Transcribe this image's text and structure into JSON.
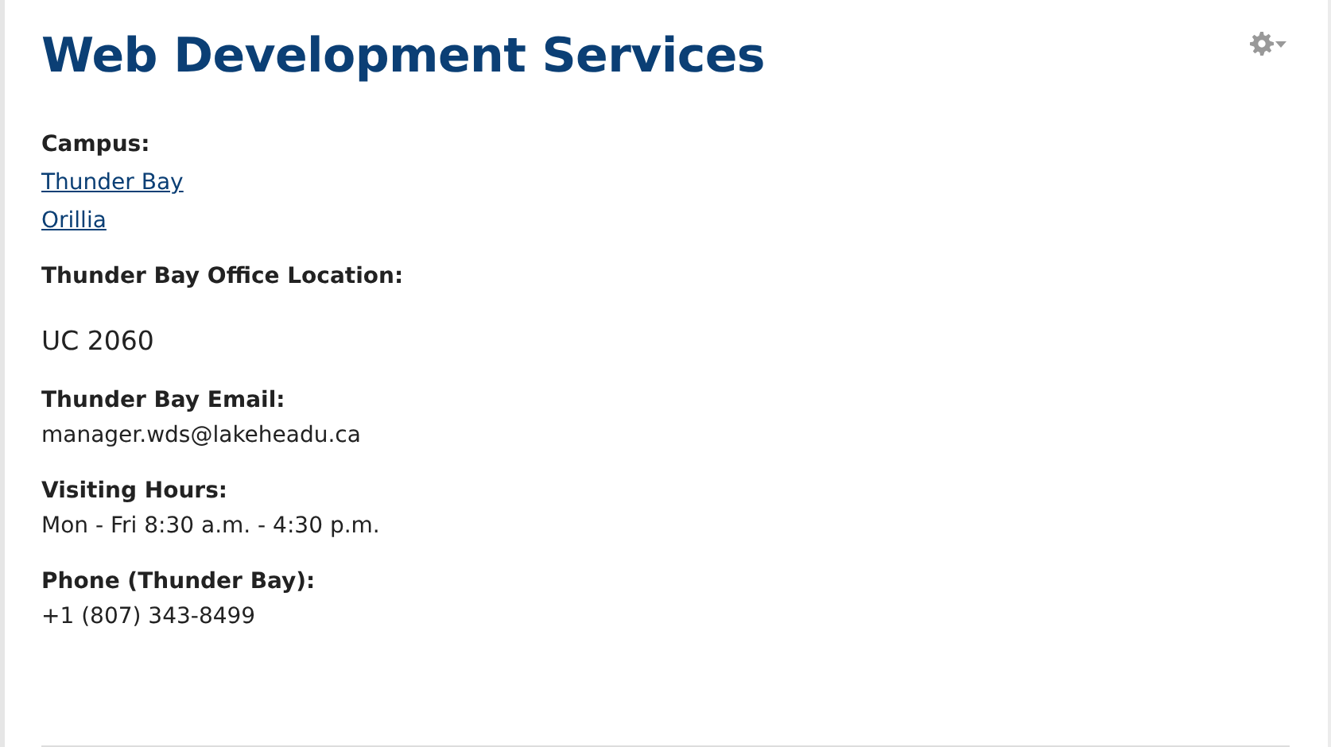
{
  "title": "Web Development Services",
  "fields": [
    {
      "label": "Campus:",
      "kind": "links",
      "values": [
        "Thunder Bay",
        "Orillia"
      ]
    },
    {
      "label": "Thunder Bay Office Location:",
      "kind": "paragraph",
      "values": [
        "UC 2060"
      ]
    },
    {
      "label": "Thunder Bay Email:",
      "kind": "text",
      "values": [
        "manager.wds@lakeheadu.ca"
      ]
    },
    {
      "label": "Visiting Hours:",
      "kind": "text",
      "values": [
        "Mon - Fri 8:30 a.m. - 4:30 p.m."
      ]
    },
    {
      "label": "Phone (Thunder Bay):",
      "kind": "text",
      "values": [
        "+1 (807) 343-8499"
      ]
    }
  ]
}
